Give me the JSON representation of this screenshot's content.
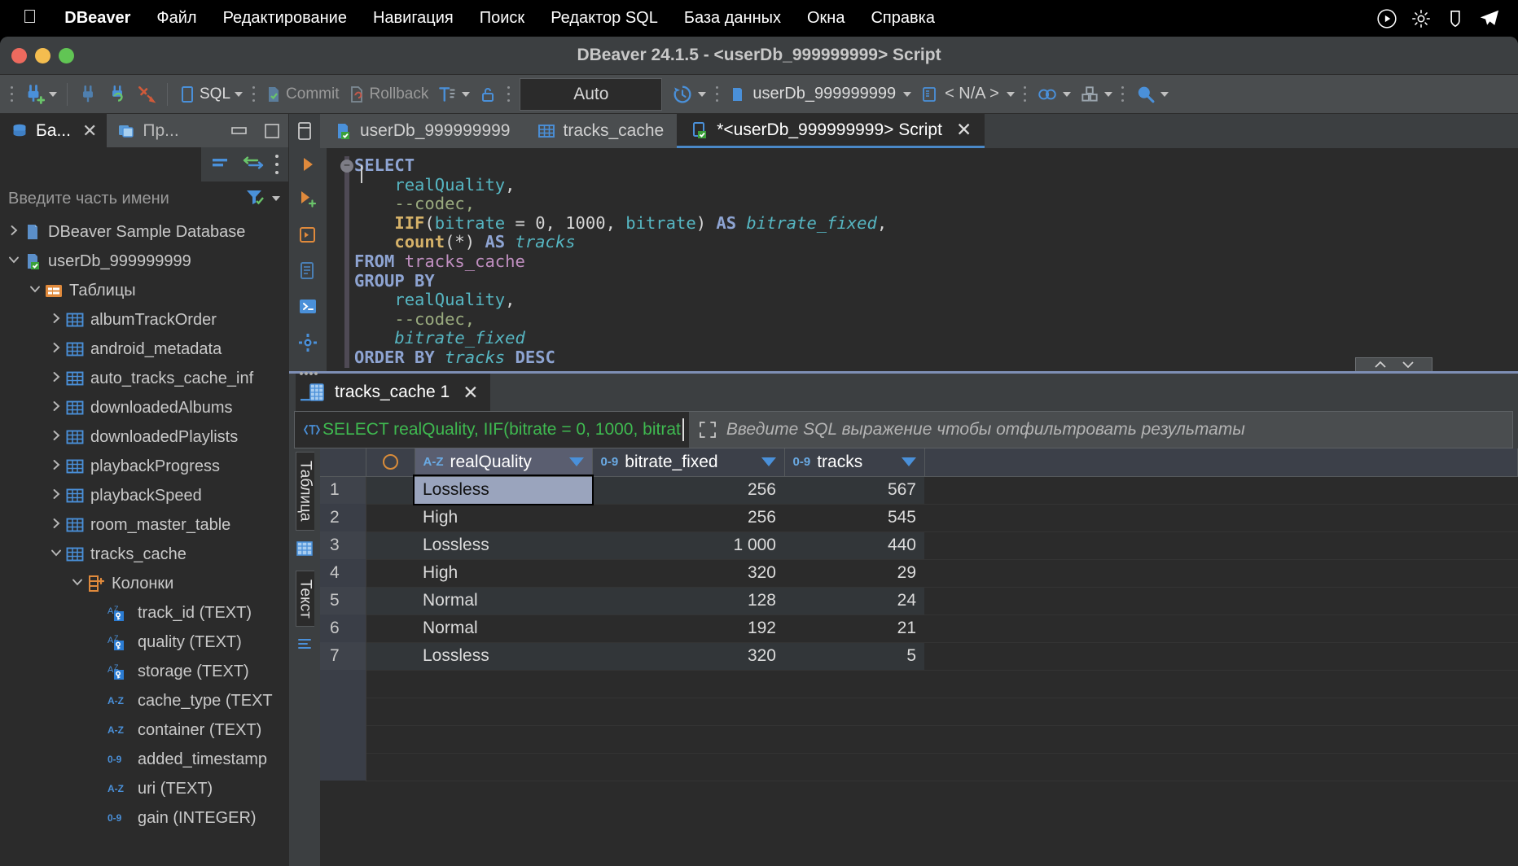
{
  "menubar": {
    "apple": "apple-logo",
    "items": [
      {
        "label": "DBeaver",
        "bold": true
      },
      {
        "label": "Файл",
        "bold": false
      },
      {
        "label": "Редактирование",
        "bold": false
      },
      {
        "label": "Навигация",
        "bold": false
      },
      {
        "label": "Поиск",
        "bold": false
      },
      {
        "label": "Редактор SQL",
        "bold": false
      },
      {
        "label": "База данных",
        "bold": false
      },
      {
        "label": "Окна",
        "bold": false
      },
      {
        "label": "Справка",
        "bold": false
      }
    ],
    "status_icons": [
      "play-circle-icon",
      "brightness-icon",
      "shield-icon",
      "telegram-icon"
    ]
  },
  "window": {
    "title": "DBeaver 24.1.5 - <userDb_999999999> Script"
  },
  "toolbar": {
    "sql_label": "SQL",
    "commit_label": "Commit",
    "rollback_label": "Rollback",
    "auto_label": "Auto",
    "connection_label": "userDb_999999999",
    "schema_label": "< N/A >"
  },
  "left_panel": {
    "tabs": [
      {
        "label": "Ба...",
        "active": true,
        "icon": "database-icon",
        "closable": true
      },
      {
        "label": "Пр...",
        "active": false,
        "icon": "projects-icon",
        "closable": false
      }
    ],
    "filter_placeholder": "Введите часть имени",
    "tree": [
      {
        "depth": 0,
        "arrow": "right",
        "icon": "db-icon",
        "label": "DBeaver Sample Database"
      },
      {
        "depth": 0,
        "arrow": "down",
        "icon": "db-connected-icon",
        "label": "userDb_999999999"
      },
      {
        "depth": 1,
        "arrow": "down",
        "icon": "folder-tables-icon",
        "label": "Таблицы"
      },
      {
        "depth": 2,
        "arrow": "right",
        "icon": "table-icon",
        "label": "albumTrackOrder"
      },
      {
        "depth": 2,
        "arrow": "right",
        "icon": "table-icon",
        "label": "android_metadata"
      },
      {
        "depth": 2,
        "arrow": "right",
        "icon": "table-icon",
        "label": "auto_tracks_cache_inf"
      },
      {
        "depth": 2,
        "arrow": "right",
        "icon": "table-icon",
        "label": "downloadedAlbums"
      },
      {
        "depth": 2,
        "arrow": "right",
        "icon": "table-icon",
        "label": "downloadedPlaylists"
      },
      {
        "depth": 2,
        "arrow": "right",
        "icon": "table-icon",
        "label": "playbackProgress"
      },
      {
        "depth": 2,
        "arrow": "right",
        "icon": "table-icon",
        "label": "playbackSpeed"
      },
      {
        "depth": 2,
        "arrow": "right",
        "icon": "table-icon",
        "label": "room_master_table"
      },
      {
        "depth": 2,
        "arrow": "down",
        "icon": "table-icon",
        "label": "tracks_cache"
      },
      {
        "depth": 3,
        "arrow": "down",
        "icon": "columns-icon",
        "label": "Колонки"
      },
      {
        "depth": 4,
        "arrow": "none",
        "icon": "az-key-icon",
        "label": "track_id (TEXT)"
      },
      {
        "depth": 4,
        "arrow": "none",
        "icon": "az-key-icon",
        "label": "quality (TEXT)"
      },
      {
        "depth": 4,
        "arrow": "none",
        "icon": "az-key-icon",
        "label": "storage (TEXT)"
      },
      {
        "depth": 4,
        "arrow": "none",
        "icon": "az-icon",
        "label": "cache_type (TEXT"
      },
      {
        "depth": 4,
        "arrow": "none",
        "icon": "az-icon",
        "label": "container (TEXT)"
      },
      {
        "depth": 4,
        "arrow": "none",
        "icon": "num-icon",
        "label": "added_timestamp"
      },
      {
        "depth": 4,
        "arrow": "none",
        "icon": "az-icon",
        "label": "uri (TEXT)"
      },
      {
        "depth": 4,
        "arrow": "none",
        "icon": "num-icon",
        "label": "gain (INTEGER)"
      }
    ]
  },
  "editor": {
    "tabs": [
      {
        "label": "userDb_999999999",
        "icon": "db-connected-icon",
        "active": false,
        "closable": false
      },
      {
        "label": "tracks_cache",
        "icon": "table-icon",
        "active": false,
        "closable": false
      },
      {
        "label": "*<userDb_999999999> Script",
        "icon": "script-icon",
        "active": true,
        "closable": true
      }
    ],
    "code_lines": [
      [
        {
          "t": "SELECT",
          "c": "k"
        }
      ],
      [
        {
          "t": "    ",
          "c": "pl"
        },
        {
          "t": "realQuality",
          "c": "id"
        },
        {
          "t": ",",
          "c": "pl"
        }
      ],
      [
        {
          "t": "    ",
          "c": "pl"
        },
        {
          "t": "--codec,",
          "c": "cm"
        }
      ],
      [
        {
          "t": "    ",
          "c": "pl"
        },
        {
          "t": "IIF",
          "c": "fn"
        },
        {
          "t": "(",
          "c": "pl"
        },
        {
          "t": "bitrate",
          "c": "id"
        },
        {
          "t": " = ",
          "c": "pl"
        },
        {
          "t": "0",
          "c": "num"
        },
        {
          "t": ", ",
          "c": "pl"
        },
        {
          "t": "1000",
          "c": "num"
        },
        {
          "t": ", ",
          "c": "pl"
        },
        {
          "t": "bitrate",
          "c": "id"
        },
        {
          "t": ") ",
          "c": "pl"
        },
        {
          "t": "AS",
          "c": "k"
        },
        {
          "t": " ",
          "c": "pl"
        },
        {
          "t": "bitrate_fixed",
          "c": "ital"
        },
        {
          "t": ",",
          "c": "pl"
        }
      ],
      [
        {
          "t": "    ",
          "c": "pl"
        },
        {
          "t": "count",
          "c": "fn"
        },
        {
          "t": "(*) ",
          "c": "pl"
        },
        {
          "t": "AS",
          "c": "k"
        },
        {
          "t": " ",
          "c": "pl"
        },
        {
          "t": "tracks",
          "c": "ital"
        }
      ],
      [
        {
          "t": "FROM",
          "c": "k"
        },
        {
          "t": " ",
          "c": "pl"
        },
        {
          "t": "tracks_cache",
          "c": "tbl"
        }
      ],
      [
        {
          "t": "GROUP BY",
          "c": "k"
        }
      ],
      [
        {
          "t": "    ",
          "c": "pl"
        },
        {
          "t": "realQuality",
          "c": "id"
        },
        {
          "t": ",",
          "c": "pl"
        }
      ],
      [
        {
          "t": "    ",
          "c": "pl"
        },
        {
          "t": "--codec,",
          "c": "cm"
        }
      ],
      [
        {
          "t": "    ",
          "c": "pl"
        },
        {
          "t": "bitrate_fixed",
          "c": "ital"
        }
      ],
      [
        {
          "t": "ORDER BY",
          "c": "k"
        },
        {
          "t": " ",
          "c": "pl"
        },
        {
          "t": "tracks",
          "c": "ital"
        },
        {
          "t": " ",
          "c": "pl"
        },
        {
          "t": "DESC",
          "c": "k"
        }
      ]
    ],
    "gutter_icons": [
      "run-script-icon",
      "run-script-new-tab-icon",
      "execute-in-new-editor-icon",
      "execute-statistics-icon",
      "execute-console-icon",
      "sql-settings-icon",
      "more-icon"
    ]
  },
  "results": {
    "tab_label": "tracks_cache 1",
    "filter_sql": "SELECT realQuality, IIF(bitrate = 0, 1000, bitrat",
    "filter_placeholder": "Введите SQL выражение чтобы отфильтровать результаты",
    "vertical_tabs": [
      {
        "label": "Таблица"
      },
      {
        "label": "Текст"
      }
    ],
    "columns": [
      {
        "label": "realQuality",
        "type_mark": "A-Z",
        "selected": true
      },
      {
        "label": "bitrate_fixed",
        "type_mark": "0-9",
        "selected": false
      },
      {
        "label": "tracks",
        "type_mark": "0-9",
        "selected": false
      }
    ],
    "rows": [
      {
        "n": "1",
        "realQuality": "Lossless",
        "bitrate_fixed": "256",
        "tracks": "567"
      },
      {
        "n": "2",
        "realQuality": "High",
        "bitrate_fixed": "256",
        "tracks": "545"
      },
      {
        "n": "3",
        "realQuality": "Lossless",
        "bitrate_fixed": "1 000",
        "tracks": "440"
      },
      {
        "n": "4",
        "realQuality": "High",
        "bitrate_fixed": "320",
        "tracks": "29"
      },
      {
        "n": "5",
        "realQuality": "Normal",
        "bitrate_fixed": "128",
        "tracks": "24"
      },
      {
        "n": "6",
        "realQuality": "Normal",
        "bitrate_fixed": "192",
        "tracks": "21"
      },
      {
        "n": "7",
        "realQuality": "Lossless",
        "bitrate_fixed": "320",
        "tracks": "5"
      }
    ]
  },
  "colors": {
    "accent": "#4a88c7",
    "green": "#3fb950",
    "orange": "#d98c3a",
    "panel": "#3c3f41",
    "editor_bg": "#2b2b2b"
  }
}
